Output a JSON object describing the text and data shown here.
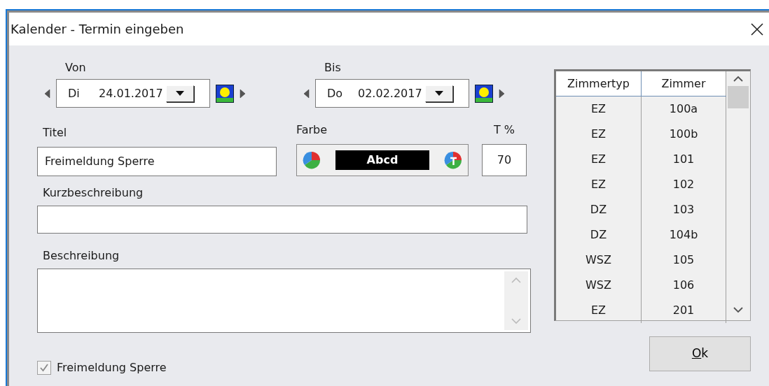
{
  "window": {
    "title": "Kalender - Termin eingeben"
  },
  "von": {
    "label": "Von",
    "weekday": "Di",
    "date": "24.01.2017"
  },
  "bis": {
    "label": "Bis",
    "weekday": "Do",
    "date": "02.02.2017"
  },
  "titel": {
    "label": "Titel",
    "value": "Freimeldung Sperre"
  },
  "farbe": {
    "label": "Farbe",
    "preview": "Abcd"
  },
  "transparenz": {
    "label": "T %",
    "value": "70"
  },
  "kurzbeschreibung": {
    "label": "Kurzbeschreibung"
  },
  "beschreibung": {
    "label": "Beschreibung"
  },
  "checkbox": {
    "label": "Freimeldung Sperre",
    "checked": true,
    "disabled": true
  },
  "table": {
    "columns": [
      "Zimmertyp",
      "Zimmer"
    ],
    "rows": [
      [
        "EZ",
        "100a"
      ],
      [
        "EZ",
        "100b"
      ],
      [
        "EZ",
        "101"
      ],
      [
        "EZ",
        "102"
      ],
      [
        "DZ",
        "103"
      ],
      [
        "DZ",
        "104b"
      ],
      [
        "WSZ",
        "105"
      ],
      [
        "WSZ",
        "106"
      ],
      [
        "EZ",
        "201"
      ]
    ]
  },
  "ok_button": {
    "label": "Ok"
  }
}
